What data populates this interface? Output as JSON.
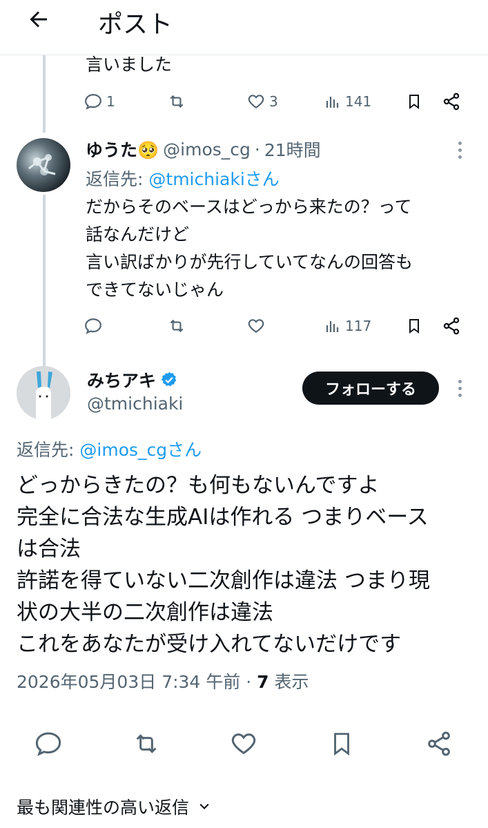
{
  "header": {
    "title": "ポスト"
  },
  "previous_tweet": {
    "text_tail": "言いました",
    "actions": {
      "replies": "1",
      "retweets": "",
      "likes": "3",
      "views": "141"
    }
  },
  "reply_tweet": {
    "name": "ゆうた🥺",
    "handle": "@imos_cg",
    "time": "21時間",
    "reply_to_label": "返信先:",
    "reply_to_handle": "@tmichiakiさん",
    "body": "だからそのベースはどっから来たの？って\n話なんだけど\n言い訳ばかりが先行していてなんの回答も\nできてないじゃん",
    "actions": {
      "replies": "",
      "retweets": "",
      "likes": "",
      "views": "117"
    }
  },
  "main_tweet": {
    "name": "みちアキ",
    "handle": "@tmichiaki",
    "follow_label": "フォローする",
    "reply_to_label": "返信先:",
    "reply_to_handle": "@imos_cgさん",
    "body": "どっからきたの？も何もないんですよ\n完全に合法な生成AIは作れる  つまりベース\nは合法\n許諾を得ていない二次創作は違法  つまり現\n状の大半の二次創作は違法\nこれをあなたが受け入れてないだけです",
    "timestamp": "2026年05月03日 7:34 午前 · ",
    "views_count": "7",
    "views_label": " 表示"
  },
  "replies_sort": {
    "label": "最も関連性の高い返信"
  },
  "colors": {
    "accent": "#1d9bf0",
    "text": "#0f1419",
    "muted": "#536471",
    "verified": "#1d9bf0"
  }
}
